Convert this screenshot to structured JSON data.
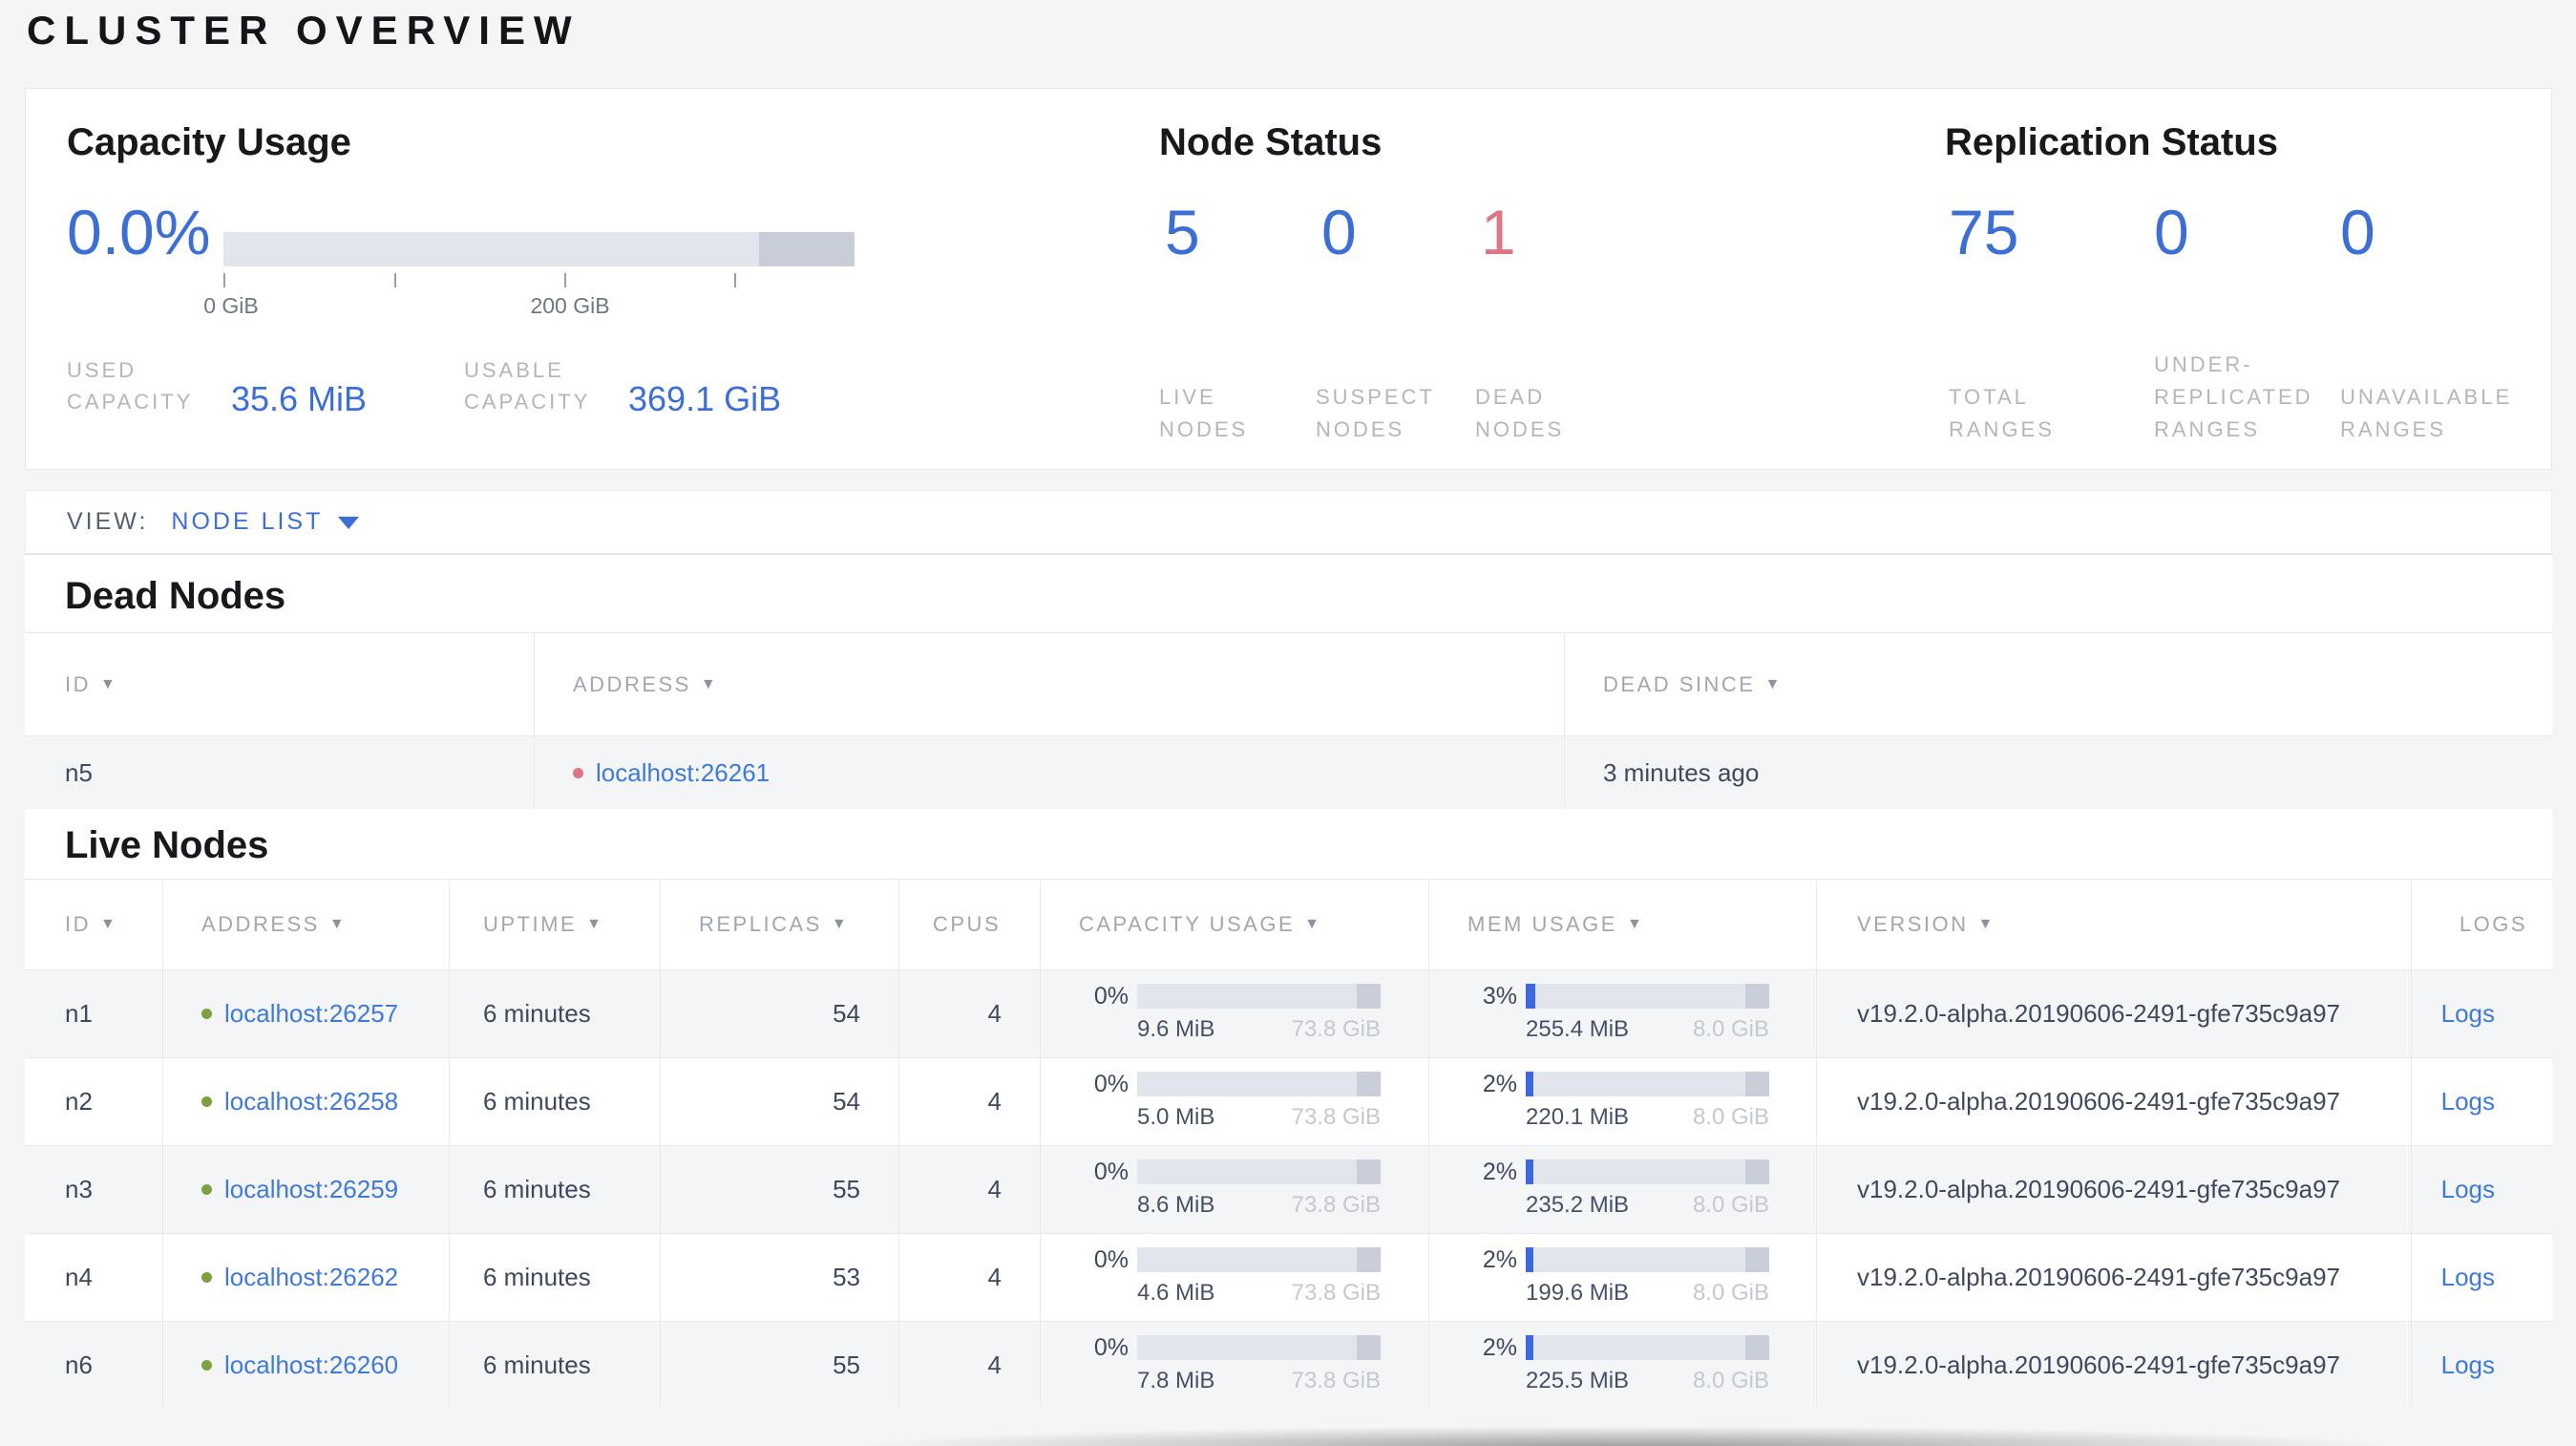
{
  "page": {
    "title": "CLUSTER OVERVIEW"
  },
  "colors": {
    "accent_blue": "#3b6fd6",
    "link_blue": "#3f7ad6",
    "dead_red": "#dd7584",
    "live_green": "#7ba23c",
    "bar_track": "#e2e5ec",
    "bar_reserved": "#c8cdd7",
    "bar_fill_blue": "#3e68e0",
    "label_gray": "#b2b6bd",
    "page_bg": "#f5f5f5"
  },
  "icons": {
    "sort": "▼",
    "caret": "▼"
  },
  "summary": {
    "capacity": {
      "title": "Capacity Usage",
      "percent": "0.0%",
      "fill_pct": 0,
      "axis": {
        "tick0": "0 GiB",
        "tick2": "200 GiB"
      },
      "used": {
        "label": "USED CAPACITY",
        "line1": "USED",
        "line2": "CAPACITY",
        "value": "35.6 MiB"
      },
      "usable": {
        "label": "USABLE CAPACITY",
        "line1": "USABLE",
        "line2": "CAPACITY",
        "value": "369.1 GiB"
      }
    },
    "nodes": {
      "title": "Node Status",
      "live": {
        "value": "5",
        "label": "LIVE NODES"
      },
      "suspect": {
        "value": "0",
        "label": "SUSPECT NODES"
      },
      "dead": {
        "value": "1",
        "label": "DEAD NODES"
      }
    },
    "replication": {
      "title": "Replication Status",
      "total": {
        "value": "75",
        "label": "TOTAL RANGES"
      },
      "underrep": {
        "value": "0",
        "label": "UNDER-REPLICATED RANGES"
      },
      "unavailable": {
        "value": "0",
        "label": "UNAVAILABLE RANGES"
      }
    }
  },
  "view_bar": {
    "label": "VIEW:",
    "selected": "NODE LIST"
  },
  "dead_nodes": {
    "heading": "Dead Nodes",
    "columns": [
      "ID",
      "ADDRESS",
      "DEAD SINCE"
    ],
    "rows": [
      {
        "id": "n5",
        "address": "localhost:26261",
        "dead_since": "3 minutes ago"
      }
    ]
  },
  "live_nodes": {
    "heading": "Live Nodes",
    "columns": [
      "ID",
      "ADDRESS",
      "UPTIME",
      "REPLICAS",
      "CPUS",
      "CAPACITY USAGE",
      "MEM USAGE",
      "VERSION",
      "LOGS"
    ],
    "logs_label": "Logs",
    "rows": [
      {
        "id": "n1",
        "address": "localhost:26257",
        "uptime": "6 minutes",
        "replicas": "54",
        "cpus": "4",
        "cap": {
          "pct": "0%",
          "used": "9.6 MiB",
          "total": "73.8 GiB",
          "fill": 0
        },
        "mem": {
          "pct": "3%",
          "used": "255.4 MiB",
          "total": "8.0 GiB",
          "fill": 3.9
        },
        "version": "v19.2.0-alpha.20190606-2491-gfe735c9a97"
      },
      {
        "id": "n2",
        "address": "localhost:26258",
        "uptime": "6 minutes",
        "replicas": "54",
        "cpus": "4",
        "cap": {
          "pct": "0%",
          "used": "5.0 MiB",
          "total": "73.8 GiB",
          "fill": 0
        },
        "mem": {
          "pct": "2%",
          "used": "220.1 MiB",
          "total": "8.0 GiB",
          "fill": 3.1
        },
        "version": "v19.2.0-alpha.20190606-2491-gfe735c9a97"
      },
      {
        "id": "n3",
        "address": "localhost:26259",
        "uptime": "6 minutes",
        "replicas": "55",
        "cpus": "4",
        "cap": {
          "pct": "0%",
          "used": "8.6 MiB",
          "total": "73.8 GiB",
          "fill": 0
        },
        "mem": {
          "pct": "2%",
          "used": "235.2 MiB",
          "total": "8.0 GiB",
          "fill": 3.1
        },
        "version": "v19.2.0-alpha.20190606-2491-gfe735c9a97"
      },
      {
        "id": "n4",
        "address": "localhost:26262",
        "uptime": "6 minutes",
        "replicas": "53",
        "cpus": "4",
        "cap": {
          "pct": "0%",
          "used": "4.6 MiB",
          "total": "73.8 GiB",
          "fill": 0
        },
        "mem": {
          "pct": "2%",
          "used": "199.6 MiB",
          "total": "8.0 GiB",
          "fill": 3.1
        },
        "version": "v19.2.0-alpha.20190606-2491-gfe735c9a97"
      },
      {
        "id": "n6",
        "address": "localhost:26260",
        "uptime": "6 minutes",
        "replicas": "55",
        "cpus": "4",
        "cap": {
          "pct": "0%",
          "used": "7.8 MiB",
          "total": "73.8 GiB",
          "fill": 0
        },
        "mem": {
          "pct": "2%",
          "used": "225.5 MiB",
          "total": "8.0 GiB",
          "fill": 3.1
        },
        "version": "v19.2.0-alpha.20190606-2491-gfe735c9a97"
      }
    ]
  }
}
